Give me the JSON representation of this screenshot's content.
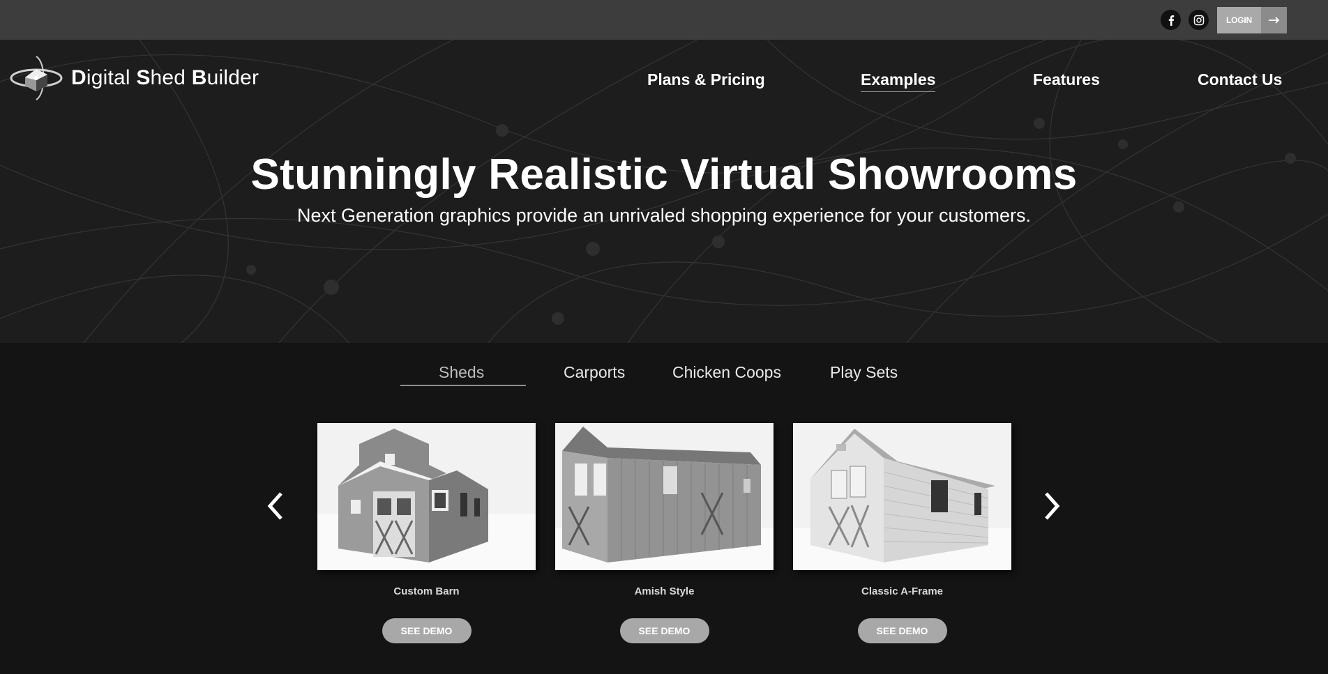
{
  "topbar": {
    "social": [
      {
        "name": "facebook-icon",
        "glyph": "f"
      },
      {
        "name": "instagram-icon"
      }
    ],
    "login_label": "LOGIN"
  },
  "header": {
    "logo": {
      "brand": "Digital Shed Builder",
      "parts": [
        [
          "D",
          "igital "
        ],
        [
          "S",
          "hed "
        ],
        [
          "B",
          "uilder"
        ]
      ]
    },
    "nav": [
      {
        "label": "Plans & Pricing",
        "active": false
      },
      {
        "label": "Examples",
        "active": true
      },
      {
        "label": "Features",
        "active": false
      },
      {
        "label": "Contact Us",
        "active": false
      }
    ]
  },
  "hero": {
    "title": "Stunningly Realistic Virtual Showrooms",
    "subtitle": "Next Generation graphics provide an unrivaled shopping experience for your customers."
  },
  "tabs": [
    {
      "label": "Sheds",
      "active": true
    },
    {
      "label": "Carports",
      "active": false
    },
    {
      "label": "Chicken Coops",
      "active": false
    },
    {
      "label": "Play Sets",
      "active": false
    }
  ],
  "carousel": {
    "prev_icon": "chevron-left-icon",
    "next_icon": "chevron-right-icon",
    "cards": [
      {
        "title": "Custom Barn",
        "button": "SEE DEMO"
      },
      {
        "title": "Amish Style",
        "button": "SEE DEMO"
      },
      {
        "title": "Classic A-Frame",
        "button": "SEE DEMO"
      }
    ]
  },
  "colors": {
    "topbar": "#3d3d3d",
    "hero_bg": "#1d1d1d",
    "page_bg": "#141414",
    "button_gray": "#a8a8a8"
  }
}
